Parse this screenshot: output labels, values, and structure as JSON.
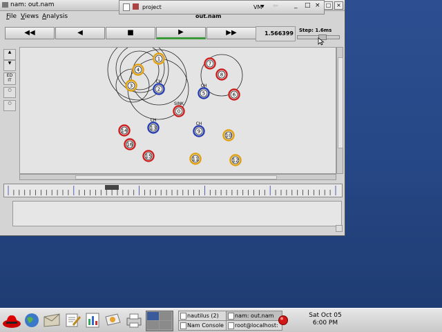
{
  "window": {
    "title": "nam: out.nam",
    "filename": "out.nam",
    "menu": [
      "File",
      "Views",
      "Analysis"
    ]
  },
  "project_window": {
    "title": "project",
    "menu_label": "VM"
  },
  "playback": {
    "buttons": [
      "rewind",
      "step-back",
      "stop",
      "play",
      "fast-forward"
    ],
    "glyphs": [
      "◀◀",
      "◀",
      "■",
      "▶",
      "▶▶"
    ],
    "time": "1.566399",
    "step": "Step: 1.6ms"
  },
  "tools": [
    "zoom-in",
    "zoom-out",
    "EDIT",
    "circle-a",
    "circle-b"
  ],
  "nodes": [
    {
      "id": "0",
      "label": "SINK",
      "color": "#cc2222"
    },
    {
      "id": "1",
      "label": "",
      "color": "#e0a010"
    },
    {
      "id": "2",
      "label": "CH",
      "color": "#2a3fb0"
    },
    {
      "id": "3",
      "label": "",
      "color": "#e0a010"
    },
    {
      "id": "4",
      "label": "",
      "color": "#e0a010"
    },
    {
      "id": "5",
      "label": "CH",
      "color": "#2a3fb0"
    },
    {
      "id": "6",
      "label": "",
      "color": "#cc2222"
    },
    {
      "id": "7",
      "label": "",
      "color": "#cc2222"
    },
    {
      "id": "8",
      "label": "",
      "color": "#cc2222"
    },
    {
      "id": "9",
      "label": "CH",
      "color": "#2a3fb0"
    },
    {
      "id": "10",
      "label": "",
      "color": "#e0a010"
    },
    {
      "id": "11",
      "label": "",
      "color": "#e0a010"
    },
    {
      "id": "12",
      "label": "",
      "color": "#e0a010"
    },
    {
      "id": "13",
      "label": "CH",
      "color": "#2a3fb0"
    },
    {
      "id": "14",
      "label": "",
      "color": "#cc2222"
    },
    {
      "id": "15",
      "label": "",
      "color": "#cc2222"
    },
    {
      "id": "16",
      "label": "",
      "color": "#cc2222"
    }
  ],
  "taskbar": {
    "tasks": [
      "nautilus (2)",
      "nam: out.nam",
      "Nam Console v",
      "root@localhost:"
    ],
    "date": "Sat Oct 05",
    "time": "6:00 PM"
  },
  "colors": {
    "desktop": "#2a4a8a",
    "ch": "#2a3fb0",
    "sink": "#cc2222",
    "member": "#e0a010"
  }
}
